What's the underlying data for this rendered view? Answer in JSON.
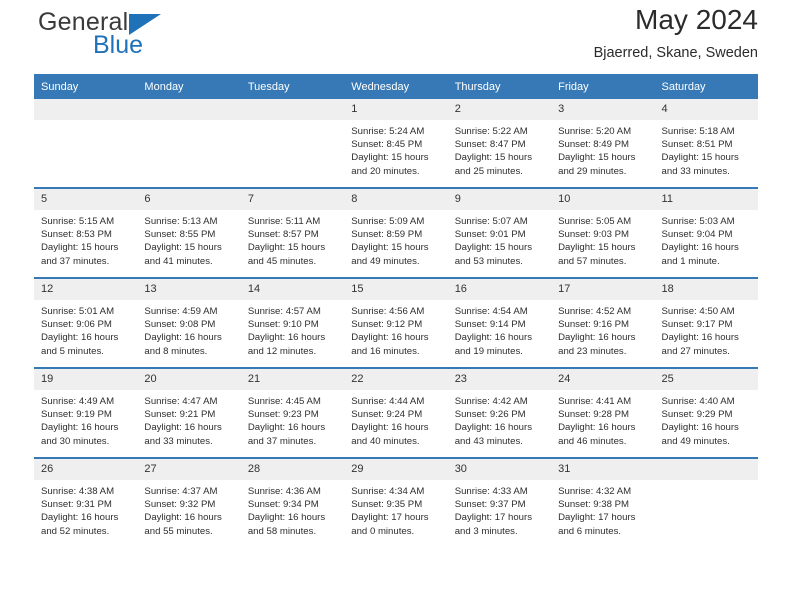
{
  "brand": {
    "name_part1": "General",
    "name_part2": "Blue",
    "triangle_icon": "brand-triangle-icon",
    "accent_color": "#1f72b8"
  },
  "header": {
    "title": "May 2024",
    "location": "Bjaerred, Skane, Sweden"
  },
  "calendar": {
    "header_bg": "#3679b6",
    "header_text_color": "#ffffff",
    "daynum_bg": "#efefef",
    "weekdays": [
      "Sunday",
      "Monday",
      "Tuesday",
      "Wednesday",
      "Thursday",
      "Friday",
      "Saturday"
    ],
    "weeks": [
      [
        {
          "day": "",
          "blank": true,
          "sunrise": "",
          "sunset": "",
          "daylight_line1": "",
          "daylight_line2": ""
        },
        {
          "day": "",
          "blank": true,
          "sunrise": "",
          "sunset": "",
          "daylight_line1": "",
          "daylight_line2": ""
        },
        {
          "day": "",
          "blank": true,
          "sunrise": "",
          "sunset": "",
          "daylight_line1": "",
          "daylight_line2": ""
        },
        {
          "day": "1",
          "blank": false,
          "sunrise": "Sunrise: 5:24 AM",
          "sunset": "Sunset: 8:45 PM",
          "daylight_line1": "Daylight: 15 hours",
          "daylight_line2": "and 20 minutes."
        },
        {
          "day": "2",
          "blank": false,
          "sunrise": "Sunrise: 5:22 AM",
          "sunset": "Sunset: 8:47 PM",
          "daylight_line1": "Daylight: 15 hours",
          "daylight_line2": "and 25 minutes."
        },
        {
          "day": "3",
          "blank": false,
          "sunrise": "Sunrise: 5:20 AM",
          "sunset": "Sunset: 8:49 PM",
          "daylight_line1": "Daylight: 15 hours",
          "daylight_line2": "and 29 minutes."
        },
        {
          "day": "4",
          "blank": false,
          "sunrise": "Sunrise: 5:18 AM",
          "sunset": "Sunset: 8:51 PM",
          "daylight_line1": "Daylight: 15 hours",
          "daylight_line2": "and 33 minutes."
        }
      ],
      [
        {
          "day": "5",
          "blank": false,
          "sunrise": "Sunrise: 5:15 AM",
          "sunset": "Sunset: 8:53 PM",
          "daylight_line1": "Daylight: 15 hours",
          "daylight_line2": "and 37 minutes."
        },
        {
          "day": "6",
          "blank": false,
          "sunrise": "Sunrise: 5:13 AM",
          "sunset": "Sunset: 8:55 PM",
          "daylight_line1": "Daylight: 15 hours",
          "daylight_line2": "and 41 minutes."
        },
        {
          "day": "7",
          "blank": false,
          "sunrise": "Sunrise: 5:11 AM",
          "sunset": "Sunset: 8:57 PM",
          "daylight_line1": "Daylight: 15 hours",
          "daylight_line2": "and 45 minutes."
        },
        {
          "day": "8",
          "blank": false,
          "sunrise": "Sunrise: 5:09 AM",
          "sunset": "Sunset: 8:59 PM",
          "daylight_line1": "Daylight: 15 hours",
          "daylight_line2": "and 49 minutes."
        },
        {
          "day": "9",
          "blank": false,
          "sunrise": "Sunrise: 5:07 AM",
          "sunset": "Sunset: 9:01 PM",
          "daylight_line1": "Daylight: 15 hours",
          "daylight_line2": "and 53 minutes."
        },
        {
          "day": "10",
          "blank": false,
          "sunrise": "Sunrise: 5:05 AM",
          "sunset": "Sunset: 9:03 PM",
          "daylight_line1": "Daylight: 15 hours",
          "daylight_line2": "and 57 minutes."
        },
        {
          "day": "11",
          "blank": false,
          "sunrise": "Sunrise: 5:03 AM",
          "sunset": "Sunset: 9:04 PM",
          "daylight_line1": "Daylight: 16 hours",
          "daylight_line2": "and 1 minute."
        }
      ],
      [
        {
          "day": "12",
          "blank": false,
          "sunrise": "Sunrise: 5:01 AM",
          "sunset": "Sunset: 9:06 PM",
          "daylight_line1": "Daylight: 16 hours",
          "daylight_line2": "and 5 minutes."
        },
        {
          "day": "13",
          "blank": false,
          "sunrise": "Sunrise: 4:59 AM",
          "sunset": "Sunset: 9:08 PM",
          "daylight_line1": "Daylight: 16 hours",
          "daylight_line2": "and 8 minutes."
        },
        {
          "day": "14",
          "blank": false,
          "sunrise": "Sunrise: 4:57 AM",
          "sunset": "Sunset: 9:10 PM",
          "daylight_line1": "Daylight: 16 hours",
          "daylight_line2": "and 12 minutes."
        },
        {
          "day": "15",
          "blank": false,
          "sunrise": "Sunrise: 4:56 AM",
          "sunset": "Sunset: 9:12 PM",
          "daylight_line1": "Daylight: 16 hours",
          "daylight_line2": "and 16 minutes."
        },
        {
          "day": "16",
          "blank": false,
          "sunrise": "Sunrise: 4:54 AM",
          "sunset": "Sunset: 9:14 PM",
          "daylight_line1": "Daylight: 16 hours",
          "daylight_line2": "and 19 minutes."
        },
        {
          "day": "17",
          "blank": false,
          "sunrise": "Sunrise: 4:52 AM",
          "sunset": "Sunset: 9:16 PM",
          "daylight_line1": "Daylight: 16 hours",
          "daylight_line2": "and 23 minutes."
        },
        {
          "day": "18",
          "blank": false,
          "sunrise": "Sunrise: 4:50 AM",
          "sunset": "Sunset: 9:17 PM",
          "daylight_line1": "Daylight: 16 hours",
          "daylight_line2": "and 27 minutes."
        }
      ],
      [
        {
          "day": "19",
          "blank": false,
          "sunrise": "Sunrise: 4:49 AM",
          "sunset": "Sunset: 9:19 PM",
          "daylight_line1": "Daylight: 16 hours",
          "daylight_line2": "and 30 minutes."
        },
        {
          "day": "20",
          "blank": false,
          "sunrise": "Sunrise: 4:47 AM",
          "sunset": "Sunset: 9:21 PM",
          "daylight_line1": "Daylight: 16 hours",
          "daylight_line2": "and 33 minutes."
        },
        {
          "day": "21",
          "blank": false,
          "sunrise": "Sunrise: 4:45 AM",
          "sunset": "Sunset: 9:23 PM",
          "daylight_line1": "Daylight: 16 hours",
          "daylight_line2": "and 37 minutes."
        },
        {
          "day": "22",
          "blank": false,
          "sunrise": "Sunrise: 4:44 AM",
          "sunset": "Sunset: 9:24 PM",
          "daylight_line1": "Daylight: 16 hours",
          "daylight_line2": "and 40 minutes."
        },
        {
          "day": "23",
          "blank": false,
          "sunrise": "Sunrise: 4:42 AM",
          "sunset": "Sunset: 9:26 PM",
          "daylight_line1": "Daylight: 16 hours",
          "daylight_line2": "and 43 minutes."
        },
        {
          "day": "24",
          "blank": false,
          "sunrise": "Sunrise: 4:41 AM",
          "sunset": "Sunset: 9:28 PM",
          "daylight_line1": "Daylight: 16 hours",
          "daylight_line2": "and 46 minutes."
        },
        {
          "day": "25",
          "blank": false,
          "sunrise": "Sunrise: 4:40 AM",
          "sunset": "Sunset: 9:29 PM",
          "daylight_line1": "Daylight: 16 hours",
          "daylight_line2": "and 49 minutes."
        }
      ],
      [
        {
          "day": "26",
          "blank": false,
          "sunrise": "Sunrise: 4:38 AM",
          "sunset": "Sunset: 9:31 PM",
          "daylight_line1": "Daylight: 16 hours",
          "daylight_line2": "and 52 minutes."
        },
        {
          "day": "27",
          "blank": false,
          "sunrise": "Sunrise: 4:37 AM",
          "sunset": "Sunset: 9:32 PM",
          "daylight_line1": "Daylight: 16 hours",
          "daylight_line2": "and 55 minutes."
        },
        {
          "day": "28",
          "blank": false,
          "sunrise": "Sunrise: 4:36 AM",
          "sunset": "Sunset: 9:34 PM",
          "daylight_line1": "Daylight: 16 hours",
          "daylight_line2": "and 58 minutes."
        },
        {
          "day": "29",
          "blank": false,
          "sunrise": "Sunrise: 4:34 AM",
          "sunset": "Sunset: 9:35 PM",
          "daylight_line1": "Daylight: 17 hours",
          "daylight_line2": "and 0 minutes."
        },
        {
          "day": "30",
          "blank": false,
          "sunrise": "Sunrise: 4:33 AM",
          "sunset": "Sunset: 9:37 PM",
          "daylight_line1": "Daylight: 17 hours",
          "daylight_line2": "and 3 minutes."
        },
        {
          "day": "31",
          "blank": false,
          "sunrise": "Sunrise: 4:32 AM",
          "sunset": "Sunset: 9:38 PM",
          "daylight_line1": "Daylight: 17 hours",
          "daylight_line2": "and 6 minutes."
        },
        {
          "day": "",
          "blank": true,
          "sunrise": "",
          "sunset": "",
          "daylight_line1": "",
          "daylight_line2": ""
        }
      ]
    ]
  }
}
